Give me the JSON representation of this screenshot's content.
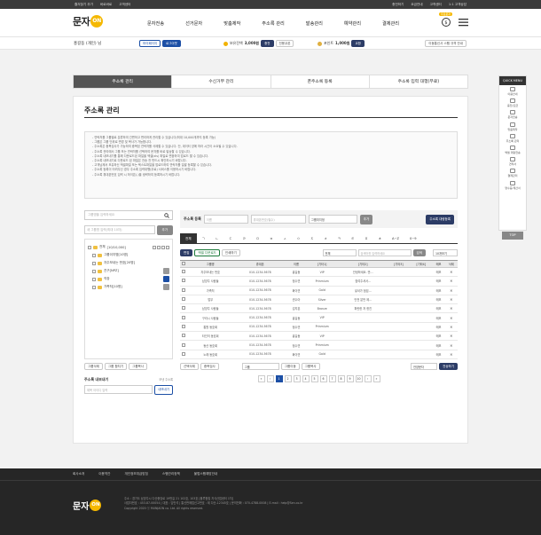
{
  "topbar": {
    "left": [
      "즐겨찾기 추가",
      "바로바로",
      "고객센터"
    ],
    "right": [
      "충전하기",
      "요금안내",
      "고객센터",
      "1:1 고객상담"
    ]
  },
  "header": {
    "logo": "문자",
    "logo_on": "ON",
    "nav": [
      "문자전송",
      "선거문자",
      "맞춤제작",
      "주소록 관리",
      "발송관리",
      "예약관리",
      "결제관리"
    ],
    "badge": "무료문자"
  },
  "info": {
    "user": "홍길동 (개인) 님",
    "mypage": "마이페이지",
    "logout": "로그아웃",
    "balance_label": "보유잔액",
    "balance": "3,000원",
    "charge": "충전",
    "coupon": "전용쿠폰",
    "point_label": "포인트",
    "point": "1,000원",
    "exchange": "교환",
    "mobile": "이동통신사 스팸 규격 안내"
  },
  "tabs": [
    "주소록 관리",
    "수신거부 관리",
    "폰주소록 등록",
    "주소록 입력 대행(무료)"
  ],
  "page_title": "주소록 관리",
  "notice": [
    "- 연락처를 그룹별로 분류하여 간편하고 편리하게 관리할 수 있습니다(최대 10,000개까지 등록 가능)",
    "- 그룹은 그룹 단위로 변경 및 복사가 가능합니다.",
    "- 주소록은 중복검사가 가능하여 중복된 연락처를 삭제할 수 있습니다. 단, 데이터 양에 따라 시간이 소요될 수 있습니다.",
    "- 주소록 관리에서 그룹 또는 연락처를 선택하여 문자를 바로 발송할 수 있습니다.",
    "- 주소록 내보내기를 통해 다운로드된 파일을 엑셀(xls) 파일로 변환하여 업로드 할 수 있습니다.",
    "- 주소록 내보내기로 다운로드 된 파일은 전송 전 반드시 확인하시기 바랍니다.",
    "- 고객님께서 보유하신 엑셀파일 또는 텍스트파일을 업로드하여 연락처를 일괄 등록할 수 있습니다.",
    "- 주소록 등록이 어려우신 경우 주소록 입력대행(무료) 서비스를 이용하시기 바랍니다.",
    "- 주소록 휴대폰번호 입력 시 하이픈(-)을 생략하여 등록하시기 바랍니다."
  ],
  "left": {
    "search_ph": "그룹명을 입력하세요",
    "add_ph": "새 그룹명 입력(최대 10자)",
    "add_btn": "추가",
    "all_group": "전체",
    "all_count": "[10/10,000]",
    "groups": [
      {
        "name": "그룹이지명[10명]"
      },
      {
        "name": "자주보내는 번호[20명]"
      },
      {
        "name": "친구[NPZ]"
      },
      {
        "name": "직장"
      },
      {
        "name": "가족처[10명]"
      }
    ],
    "b1": "그룹삭제",
    "b2": "그룹 합치기",
    "b3": "그룹복사",
    "send_title": "주소록 내보내기",
    "send_sub": "보낸 주소록",
    "send_ph": "제목 아이디 입력",
    "send_btn": "내보내기"
  },
  "reg": {
    "label": "주소록 등록",
    "name_ph": "이름",
    "phone_ph": "휴대폰번호(필수)",
    "group": "그룹미지정",
    "add": "추가",
    "bulk": "주소록 대량등록"
  },
  "alpha": [
    "전체",
    "ㄱ",
    "ㄴ",
    "ㄷ",
    "ㄹ",
    "ㅁ",
    "ㅂ",
    "ㅅ",
    "ㅇ",
    "ㅈ",
    "ㅊ",
    "ㅋ",
    "ㅌ",
    "ㅍ",
    "ㅎ",
    "A~Z",
    "0~9"
  ],
  "tools": {
    "edit": "편집",
    "excel": "엑셀 다운로드",
    "print": "인쇄하기",
    "sel": "전체",
    "search_ph": "검색어를 입력하세요",
    "search": "검색",
    "per": "10개보기"
  },
  "table": {
    "head": [
      "그룹명",
      "휴대폰",
      "이름",
      "[기타1]",
      "[기타2]",
      "[기타3]",
      "[기타4]",
      "메모",
      "삭제"
    ],
    "rows": [
      [
        "자주보내는 번호",
        "010-1234-5678",
        "홍길동",
        "VIP",
        "안녕하세요. 반...",
        "",
        "",
        "메모",
        ""
      ],
      [
        "남양주 사람들",
        "010-1234-5678",
        "정수연",
        "Prinmium",
        "참여주셔서...",
        "",
        "",
        "메모",
        ""
      ],
      [
        "가족처",
        "010-1234-5678",
        "화이연",
        "Gold",
        "넣셔가 점검...",
        "",
        "",
        "메모",
        ""
      ],
      [
        "업무",
        "010-1234-5678",
        "권수아",
        "Silver",
        "안전 분만 제...",
        "",
        "",
        "메모",
        ""
      ],
      [
        "남양주 사람들",
        "010-1234-5678",
        "김지훈",
        "Bronze",
        "파란한 저 한진",
        "",
        "",
        "메모",
        ""
      ],
      [
        "구리시 사람들",
        "010-1234-5678",
        "홍길동",
        "VIP",
        "",
        "",
        "",
        "메모",
        ""
      ],
      [
        "통원 동호회",
        "010-1234-5678",
        "정수연",
        "Prinmium",
        "",
        "",
        "",
        "메모",
        ""
      ],
      [
        "타인의 동호회",
        "010-1234-5678",
        "홍길동",
        "VIP",
        "",
        "",
        "",
        "메모",
        ""
      ],
      [
        "동산 동호회",
        "010-1234-5678",
        "정수연",
        "Prinmium",
        "",
        "",
        "",
        "메모",
        ""
      ],
      [
        "노래 동호회",
        "010-1234-5678",
        "화이연",
        "Gold",
        "",
        "",
        "",
        "메모",
        ""
      ]
    ]
  },
  "bottom": {
    "send_sel": "선택삭제",
    "del_all": "중복검사",
    "group_sel": "그룹",
    "move": "그룹이동",
    "copy": "그룹복사",
    "status": "안양문자",
    "send": "전송하기"
  },
  "pages": [
    "1",
    "2",
    "3",
    "4",
    "5",
    "6",
    "7",
    "8",
    "9",
    "10"
  ],
  "quick": {
    "title": "QUICK MENU",
    "items": [
      "이용안내",
      "충전/요금",
      "문자전송",
      "맞춤제작",
      "주소록 관리",
      "엑셀 대량전송",
      "견적서",
      "결제관리",
      "영수증/계산서"
    ],
    "top": "TOP"
  },
  "footer": {
    "links": [
      "회사소개",
      "이용약관",
      "개인정보취급방침",
      "스팸관리정책",
      "불법스팸예방안내"
    ],
    "logo": "문자",
    "logo_on": "ON",
    "info": [
      "주소 : 경기도 남양주시 다산중앙로 19번길 21 102호, 103호 [불루핑힐 지식산업센터 1차]",
      "사업자번호 : 453-87-00054  |  대표 : 임민석  |  통신판매업신고번호 : 제 다산-12345호  |  문의전화 : 070-4788-0008  |  E-mail : help@Sen.co.kr",
      "Copyright 2020 ⓒ MUNJAON co. Ltd. All rights reserved."
    ]
  }
}
